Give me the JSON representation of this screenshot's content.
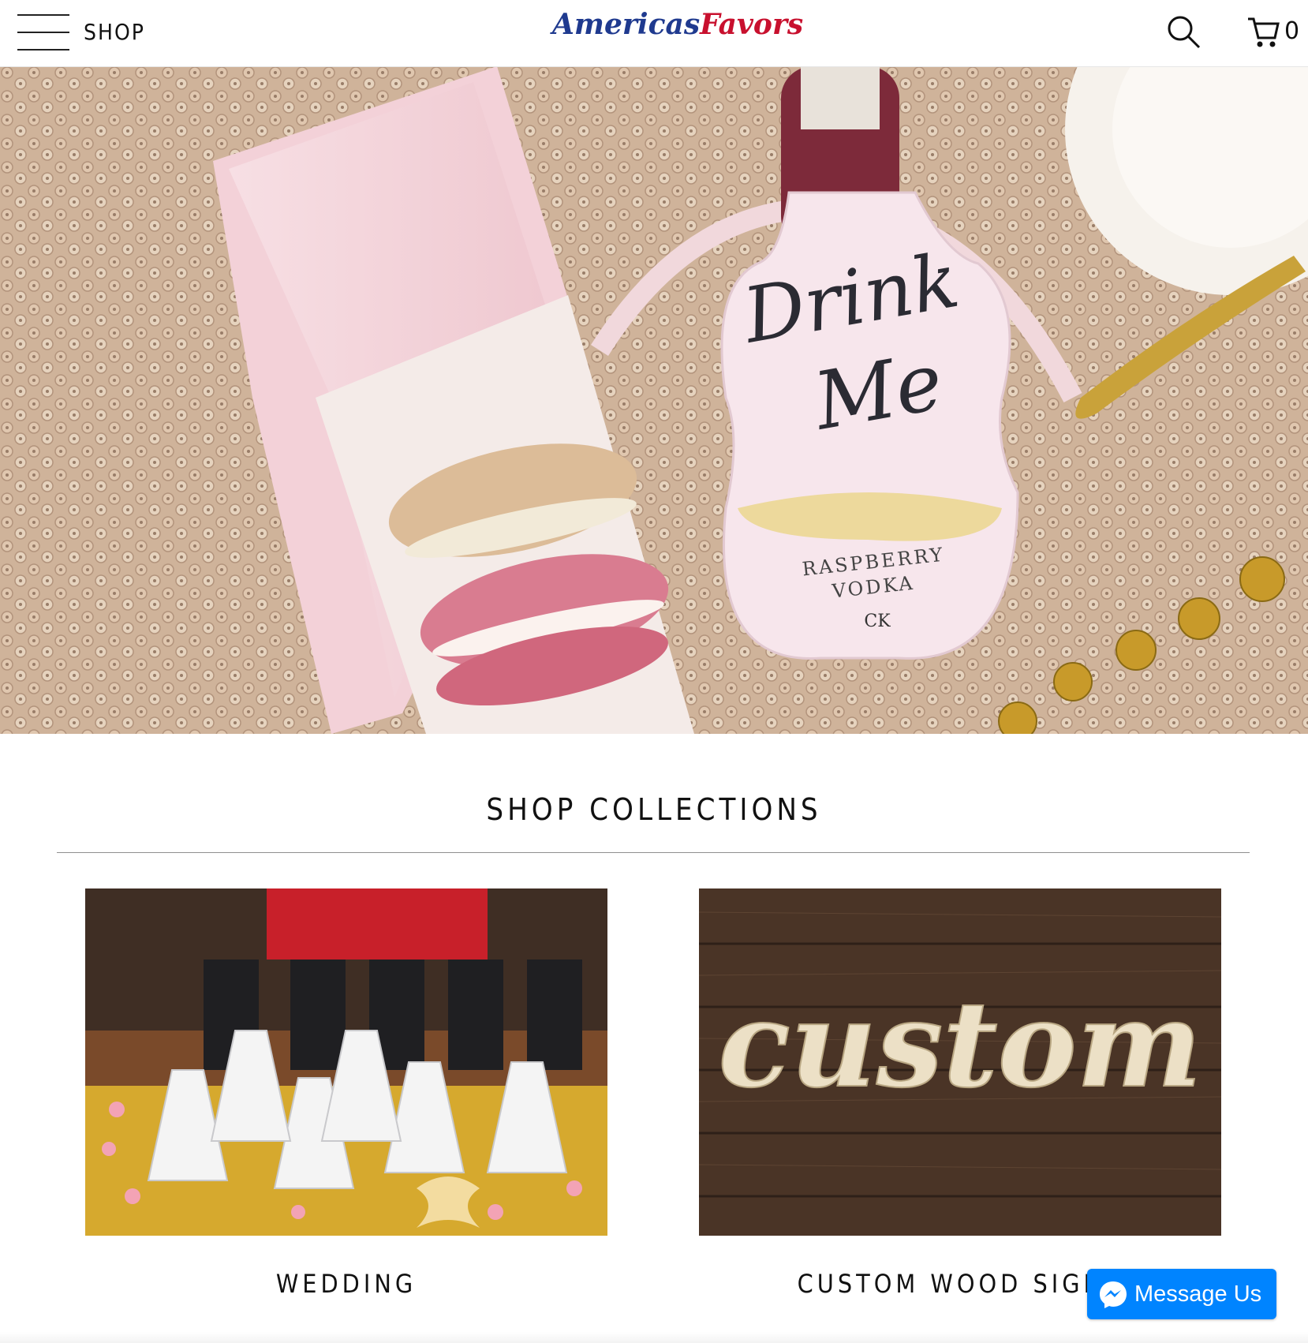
{
  "header": {
    "shop_label": "SHOP",
    "logo_part1": "Americas",
    "logo_part2": "Favors",
    "cart_count": "0"
  },
  "hero": {
    "tag_line1": "Drink",
    "tag_line2": "Me",
    "tag_product1": "RASPBERRY",
    "tag_product2": "VODKA",
    "tag_monogram": "CK"
  },
  "collections": {
    "title": "SHOP COLLECTIONS",
    "items": [
      {
        "label": "WEDDING"
      },
      {
        "label": "CUSTOM WOOD SIGNS",
        "sign_text": "custom"
      }
    ]
  },
  "chat": {
    "label": "Message Us"
  },
  "colors": {
    "logo_blue": "#1f3a8f",
    "logo_red": "#c8102e",
    "messenger_blue": "#0084ff"
  }
}
